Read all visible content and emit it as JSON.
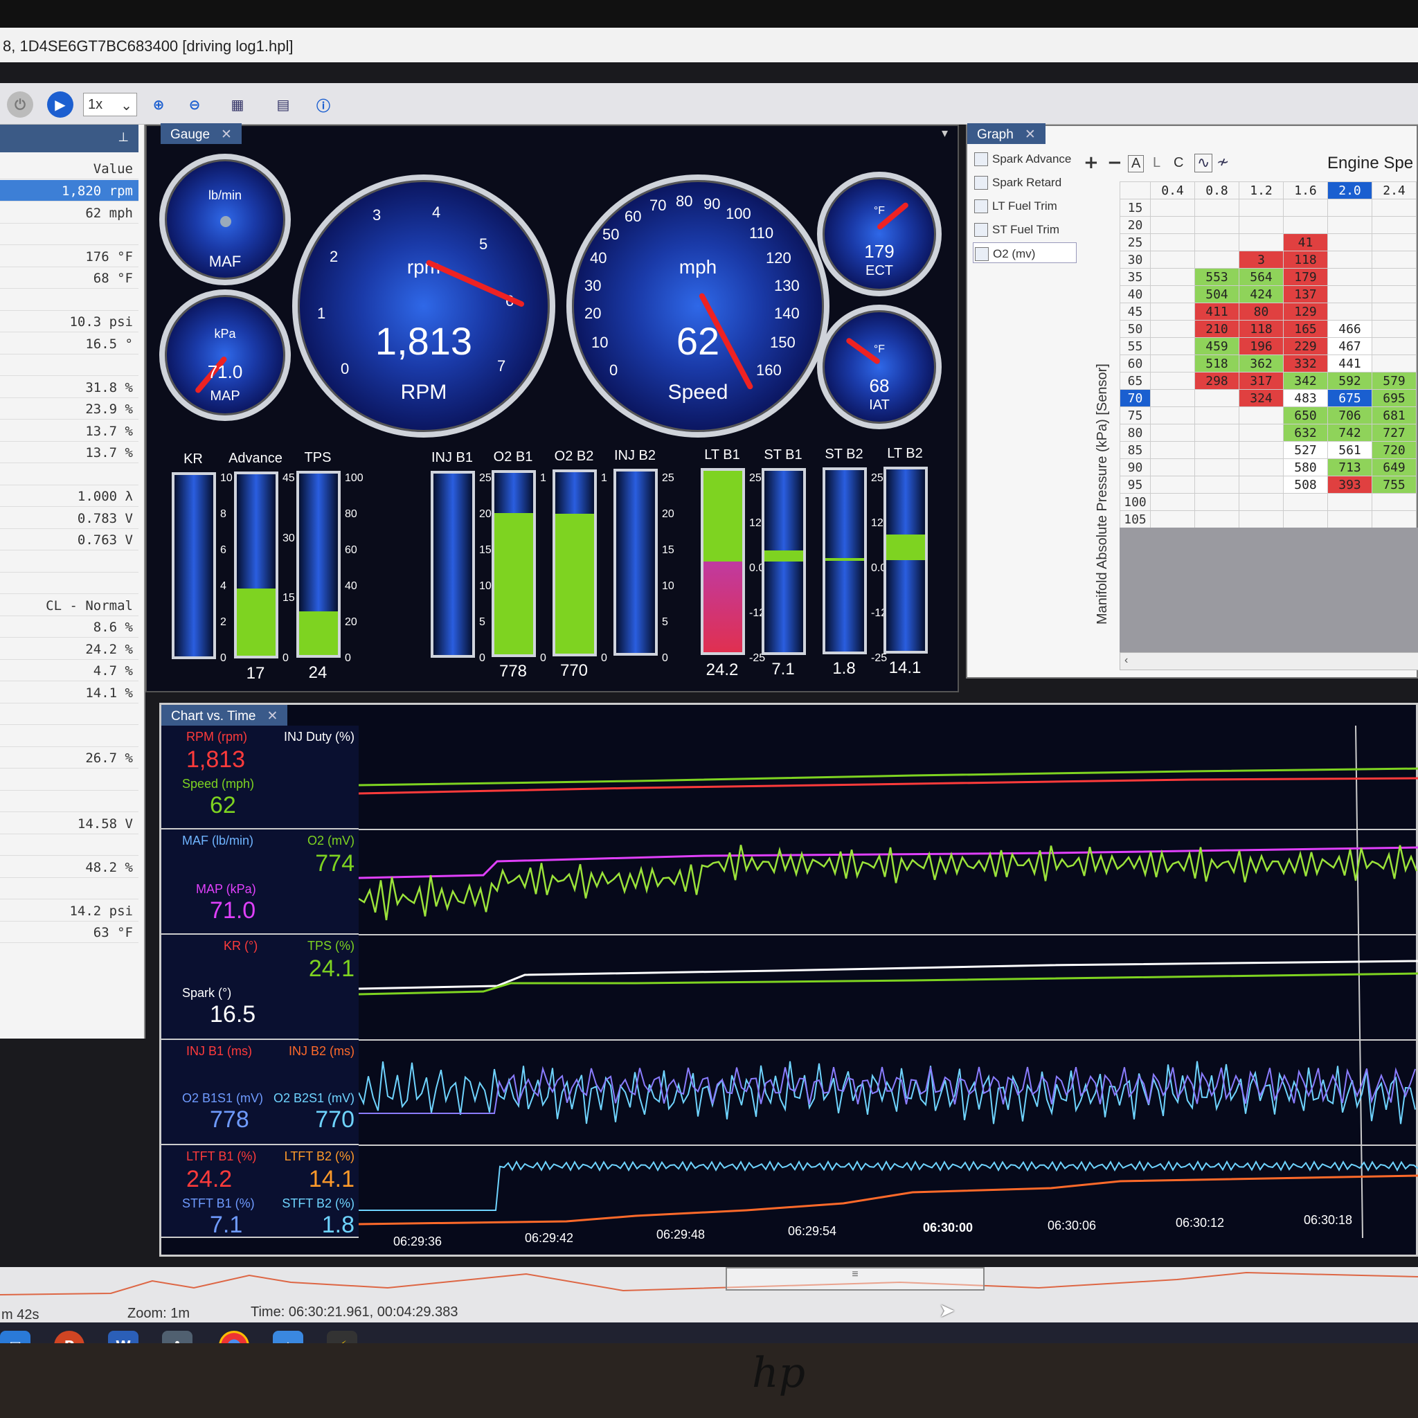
{
  "window": {
    "title": "8, 1D4SE6GT7BC683400 [driving log1.hpl]"
  },
  "toolbar": {
    "zoom": "1x"
  },
  "left_panel": {
    "header": "Value",
    "rows": [
      {
        "text": "1,820 rpm",
        "selected": true
      },
      {
        "text": "62 mph"
      },
      {
        "text": ""
      },
      {
        "text": "176 °F"
      },
      {
        "text": "68 °F"
      },
      {
        "text": ""
      },
      {
        "text": "10.3 psi"
      },
      {
        "text": "16.5 °"
      },
      {
        "text": ""
      },
      {
        "text": "31.8 %"
      },
      {
        "text": "23.9 %"
      },
      {
        "text": "13.7 %"
      },
      {
        "text": "13.7 %"
      },
      {
        "text": ""
      },
      {
        "text": "1.000 λ"
      },
      {
        "text": "0.783 V"
      },
      {
        "text": "0.763 V"
      },
      {
        "text": ""
      },
      {
        "text": ""
      },
      {
        "text": "CL - Normal"
      },
      {
        "text": "8.6 %"
      },
      {
        "text": "24.2 %"
      },
      {
        "text": "4.7 %"
      },
      {
        "text": "14.1 %"
      },
      {
        "text": ""
      },
      {
        "text": ""
      },
      {
        "text": "26.7 %"
      },
      {
        "text": ""
      },
      {
        "text": ""
      },
      {
        "text": "14.58 V"
      },
      {
        "text": ""
      },
      {
        "text": "48.2 %"
      },
      {
        "text": ""
      },
      {
        "text": "14.2 psi"
      },
      {
        "text": "63 °F"
      }
    ]
  },
  "gauge_panel": {
    "tab": "Gauge",
    "maf": {
      "unit": "lb/min",
      "name": "MAF",
      "ticks": [
        "0",
        "10",
        "20",
        "30",
        "40",
        "50",
        "60"
      ]
    },
    "map": {
      "unit": "kPa",
      "value": "71.0",
      "name": "MAP",
      "ticks": [
        "10",
        "20",
        "30",
        "40",
        "50",
        "60",
        "70",
        "80",
        "90",
        "100",
        "110"
      ]
    },
    "rpm": {
      "unit": "rpm",
      "value": "1,813",
      "name": "RPM",
      "ticks": [
        "0",
        "1",
        "2",
        "3",
        "4",
        "5",
        "6",
        "7"
      ]
    },
    "speed": {
      "unit": "mph",
      "value": "62",
      "name": "Speed",
      "ticks": [
        "0",
        "10",
        "20",
        "30",
        "40",
        "50",
        "60",
        "70",
        "80",
        "90",
        "100",
        "110",
        "120",
        "130",
        "140",
        "150",
        "160"
      ]
    },
    "ect": {
      "unit": "°F",
      "value": "179",
      "name": "ECT",
      "ticks": [
        "50",
        "75",
        "100",
        "125",
        "150",
        "175",
        "200",
        "225",
        "250"
      ]
    },
    "iat": {
      "unit": "°F",
      "value": "68",
      "name": "IAT",
      "ticks": [
        "30",
        "40",
        "50",
        "60",
        "70",
        "80",
        "90",
        "100",
        "110",
        "120",
        "130",
        "140",
        "150"
      ]
    },
    "bars": [
      {
        "label": "KR",
        "value": "",
        "fill": 0.0,
        "scale": [
          "10",
          "8",
          "6",
          "4",
          "2",
          "0"
        ]
      },
      {
        "label": "Advance",
        "value": "17",
        "fill": 0.37,
        "scale": [
          "45",
          "30",
          "15",
          "0"
        ]
      },
      {
        "label": "TPS",
        "value": "24",
        "fill": 0.24,
        "scale": [
          "100",
          "80",
          "60",
          "40",
          "20",
          "0"
        ]
      },
      {
        "label": "INJ B1",
        "value": "",
        "fill": 0.0,
        "scale": [
          "25",
          "20",
          "15",
          "10",
          "5",
          "0"
        ]
      },
      {
        "label": "O2 B1",
        "value": "778",
        "fill": 0.78,
        "scale": [
          "1",
          "0"
        ]
      },
      {
        "label": "O2 B2",
        "value": "770",
        "fill": 0.77,
        "scale": [
          "1",
          "0"
        ]
      },
      {
        "label": "INJ B2",
        "value": "",
        "fill": 0.0,
        "scale": [
          "25",
          "20",
          "15",
          "10",
          "5",
          "0"
        ]
      },
      {
        "label": "LT B1",
        "value": "24.2",
        "fill": 0.5,
        "scale": [
          "25",
          "12",
          "0.0",
          "-12",
          "-25"
        ]
      },
      {
        "label": "ST B1",
        "value": "7.1",
        "fill": 0.12,
        "scale": []
      },
      {
        "label": "ST B2",
        "value": "1.8",
        "fill": 0.03,
        "scale": [
          "25",
          "12",
          "0.0",
          "-12",
          "-25"
        ]
      },
      {
        "label": "LT B2",
        "value": "14.1",
        "fill": 0.28,
        "scale": []
      }
    ]
  },
  "graph_panel": {
    "tab": "Graph",
    "title": "Engine Spe",
    "list": [
      "Spark Advance",
      "Spark Retard",
      "LT Fuel Trim",
      "ST Fuel Trim",
      "O2 (mv)"
    ],
    "toolbar": [
      "+",
      "−",
      "A",
      "L",
      "C"
    ],
    "y_axis_label": "Manifold Absolute Pressure (kPa) [Sensor]",
    "columns": [
      "0.4",
      "0.8",
      "1.2",
      "1.6",
      "2.0",
      "2.4"
    ],
    "rows": [
      {
        "h": "15",
        "c": [
          "",
          "",
          "",
          "",
          "",
          ""
        ]
      },
      {
        "h": "20",
        "c": [
          "",
          "",
          "",
          "",
          "",
          ""
        ]
      },
      {
        "h": "25",
        "c": [
          "",
          "",
          "",
          "41",
          "",
          ""
        ]
      },
      {
        "h": "30",
        "c": [
          "",
          "",
          "3",
          "118",
          "",
          ""
        ]
      },
      {
        "h": "35",
        "c": [
          "",
          "553",
          "564",
          "179",
          "",
          ""
        ]
      },
      {
        "h": "40",
        "c": [
          "",
          "504",
          "424",
          "137",
          "",
          ""
        ]
      },
      {
        "h": "45",
        "c": [
          "",
          "411",
          "80",
          "129",
          "",
          ""
        ]
      },
      {
        "h": "50",
        "c": [
          "",
          "210",
          "118",
          "165",
          "466",
          ""
        ]
      },
      {
        "h": "55",
        "c": [
          "",
          "459",
          "196",
          "229",
          "467",
          ""
        ]
      },
      {
        "h": "60",
        "c": [
          "",
          "518",
          "362",
          "332",
          "441",
          ""
        ]
      },
      {
        "h": "65",
        "c": [
          "",
          "298",
          "317",
          "342",
          "592",
          "579"
        ]
      },
      {
        "h": "70",
        "c": [
          "",
          "",
          "324",
          "483",
          "675",
          "695"
        ]
      },
      {
        "h": "75",
        "c": [
          "",
          "",
          "",
          "650",
          "706",
          "681"
        ]
      },
      {
        "h": "80",
        "c": [
          "",
          "",
          "",
          "632",
          "742",
          "727"
        ]
      },
      {
        "h": "85",
        "c": [
          "",
          "",
          "",
          "527",
          "561",
          "720"
        ]
      },
      {
        "h": "90",
        "c": [
          "",
          "",
          "",
          "580",
          "713",
          "649"
        ]
      },
      {
        "h": "95",
        "c": [
          "",
          "",
          "",
          "508",
          "393",
          "755"
        ]
      },
      {
        "h": "100",
        "c": [
          "",
          "",
          "",
          "",
          "",
          ""
        ]
      },
      {
        "h": "105",
        "c": [
          "",
          "",
          "",
          "",
          "",
          ""
        ]
      }
    ],
    "colors": [
      [
        "",
        "",
        "",
        "",
        "",
        ""
      ],
      [
        "",
        "",
        "",
        "",
        "",
        ""
      ],
      [
        "",
        "",
        "",
        "r",
        "",
        ""
      ],
      [
        "",
        "",
        "r",
        "r",
        "",
        ""
      ],
      [
        "",
        "g",
        "g",
        "r",
        "",
        ""
      ],
      [
        "",
        "g",
        "g",
        "r",
        "",
        ""
      ],
      [
        "",
        "r",
        "r",
        "r",
        "",
        ""
      ],
      [
        "",
        "r",
        "r",
        "r",
        "w",
        ""
      ],
      [
        "",
        "g",
        "r",
        "r",
        "w",
        ""
      ],
      [
        "",
        "g",
        "g",
        "r",
        "w",
        ""
      ],
      [
        "",
        "r",
        "r",
        "g",
        "g",
        "g"
      ],
      [
        "",
        "",
        "r",
        "w",
        "b",
        "g"
      ],
      [
        "",
        "",
        "",
        "g",
        "g",
        "g"
      ],
      [
        "",
        "",
        "",
        "g",
        "g",
        "g"
      ],
      [
        "",
        "",
        "",
        "w",
        "w",
        "g"
      ],
      [
        "",
        "",
        "",
        "w",
        "g",
        "g"
      ],
      [
        "",
        "",
        "",
        "w",
        "r",
        "g"
      ],
      [
        "",
        "",
        "",
        "",
        "",
        ""
      ],
      [
        "",
        "",
        "",
        "",
        "",
        ""
      ]
    ]
  },
  "chart_panel": {
    "tab": "Chart vs. Time",
    "rows": [
      {
        "l1": "RPM (rpm)",
        "v1": "1,813",
        "l2": "INJ Duty (%)",
        "v2": "",
        "l3": "Speed (mph)",
        "v3": "62",
        "l4": "",
        "v4": ""
      },
      {
        "l1": "MAF (lb/min)",
        "v1": "",
        "l2": "O2 (mV)",
        "v2": "774",
        "l3": "MAP (kPa)",
        "v3": "71.0",
        "l4": "",
        "v4": ""
      },
      {
        "l1": "KR (°)",
        "v1": "",
        "l2": "TPS (%)",
        "v2": "24.1",
        "l3": "Spark (°)",
        "v3": "16.5",
        "l4": "",
        "v4": ""
      },
      {
        "l1": "INJ B1 (ms)",
        "v1": "",
        "l2": "INJ B2 (ms)",
        "v2": "",
        "l3": "O2 B1S1 (mV)",
        "v3": "778",
        "l4": "O2 B2S1 (mV)",
        "v4": "770"
      },
      {
        "l1": "LTFT B1 (%)",
        "v1": "24.2",
        "l2": "LTFT B2 (%)",
        "v2": "14.1",
        "l3": "STFT B1 (%)",
        "v3": "7.1",
        "l4": "STFT B2 (%)",
        "v4": "1.8"
      }
    ],
    "times": [
      "06:29:36",
      "06:29:42",
      "06:29:48",
      "06:29:54",
      "06:30:00",
      "06:30:06",
      "06:30:12",
      "06:30:18"
    ]
  },
  "status": {
    "duration": "m 42s",
    "zoom": "Zoom: 1m",
    "time": "Time: 06:30:21.961, 00:04:29.383"
  },
  "colors": {
    "accent": "#3d7fd6",
    "rpm": "#ff3b3b",
    "speed": "#7ed321",
    "map": "#e040fb",
    "o2": "#9be33a",
    "inj": "#8a7cff",
    "o2b1": "#6fd4ff",
    "ltft": "#ff6a2a"
  }
}
